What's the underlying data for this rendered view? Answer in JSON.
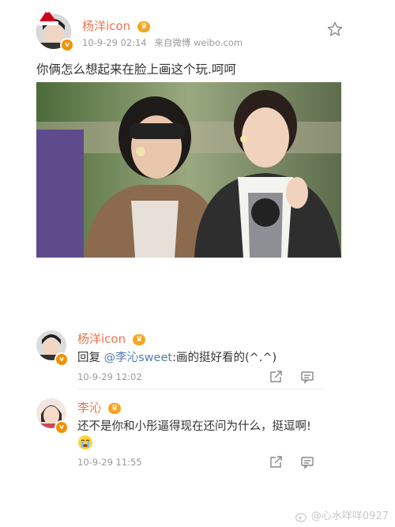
{
  "post": {
    "author": "杨洋icon",
    "time": "10-9-29 02:14",
    "source": "来自微博 weibo.com",
    "text": "你俩怎么想起来在脸上画这个玩.呵呵"
  },
  "comments": [
    {
      "author": "杨洋icon",
      "reply_prefix": "回复 ",
      "mention": "@李沁sweet",
      "text": ":画的挺好看的(^.^)",
      "time": "10-9-29 12:02"
    },
    {
      "author": "李沁",
      "text": "还不是你和小彤逼得现在还问为什么，挺逗啊!",
      "time": "10-9-29 11:55"
    }
  ],
  "watermark": "@心水咩咩0927",
  "colors": {
    "name": "#eb7350",
    "mention": "#507daf",
    "meta": "#999999",
    "badge": "#f29100"
  },
  "icons": [
    "star-icon",
    "share-icon",
    "comment-icon",
    "verified-icon",
    "member-crown-icon",
    "crying-emoji-icon"
  ]
}
